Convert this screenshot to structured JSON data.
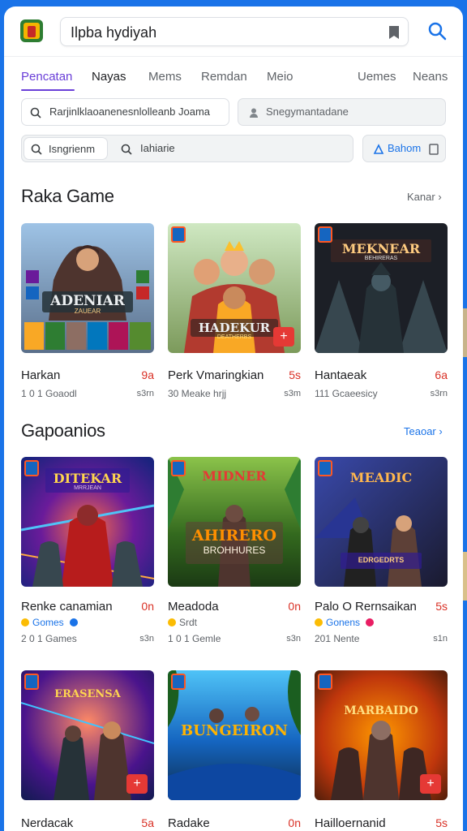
{
  "colors": {
    "accent": "#6a3fd8",
    "link": "#1a73e8",
    "rating": "#d93025",
    "frame": "#1a73e8"
  },
  "header": {
    "search_value": "Ilpba hydiyah",
    "logo_icon": "game-controller-logo"
  },
  "tabs": [
    {
      "label": "Pencatan",
      "active": true
    },
    {
      "label": "Nayas"
    },
    {
      "label": "Mems"
    },
    {
      "label": "Remdan"
    },
    {
      "label": "Meio"
    },
    {
      "label": "Uemes"
    },
    {
      "label": "Neans"
    }
  ],
  "filters": {
    "row1_left": "Rarjinlklaoanenesnlolleanb Joama",
    "row1_right": "Snegymantadane",
    "row2_a": "Isngrienm",
    "row2_b": "Iahiarie",
    "row2_action": "Bahom"
  },
  "sections": [
    {
      "title": "Raka Game",
      "link": "Kanar",
      "cards": [
        {
          "name": "Harkan",
          "rating": "9a",
          "meta": "1 0 1 Goaodl",
          "meta_right": "s3rn",
          "art": "ADENIAR",
          "art_sub": "ZAUEAR"
        },
        {
          "name": "Perk Vmaringkian",
          "rating": "5s",
          "meta": "30 Meake hrjj",
          "meta_right": "s3m",
          "art": "HADEKUR",
          "art_sub": "DEATHERBS"
        },
        {
          "name": "Hantaeak",
          "rating": "6a",
          "meta": "111 Gcaeesicy",
          "meta_right": "s3rn",
          "art": "MEKNEAR",
          "art_sub": "BEHIRERAS"
        }
      ]
    },
    {
      "title": "Gapoanios",
      "link": "Teaoar",
      "cards": [
        {
          "name": "Renke canamian",
          "rating": "0n",
          "tag": "Gomes",
          "meta": "2 0 1 Games",
          "meta_right": "s3n",
          "art": "DITEKAR",
          "art_sub": "MRRJEAN"
        },
        {
          "name": "Meadoda",
          "rating": "0n",
          "tag": "Srdt",
          "meta": "1 0 1 Gemle",
          "meta_right": "s3n",
          "art": "AHIRERO",
          "art_sub": "BROHHURES",
          "top": "MIDNER"
        },
        {
          "name": "Palo O Rernsaikan",
          "rating": "5s",
          "tag": "Gonens",
          "meta": "201 Nente",
          "meta_right": "s1n",
          "art": "MEADIC",
          "art_sub": "EDRGEDRTS"
        }
      ]
    },
    {
      "cards": [
        {
          "name": "Nerdacak",
          "rating": "5a",
          "art": "ERASENSA"
        },
        {
          "name": "Radake",
          "rating": "0n",
          "art": "BUNGEIRON"
        },
        {
          "name": "Hailloernanid",
          "rating": "5s",
          "art": "MARBAIDO"
        }
      ]
    }
  ]
}
